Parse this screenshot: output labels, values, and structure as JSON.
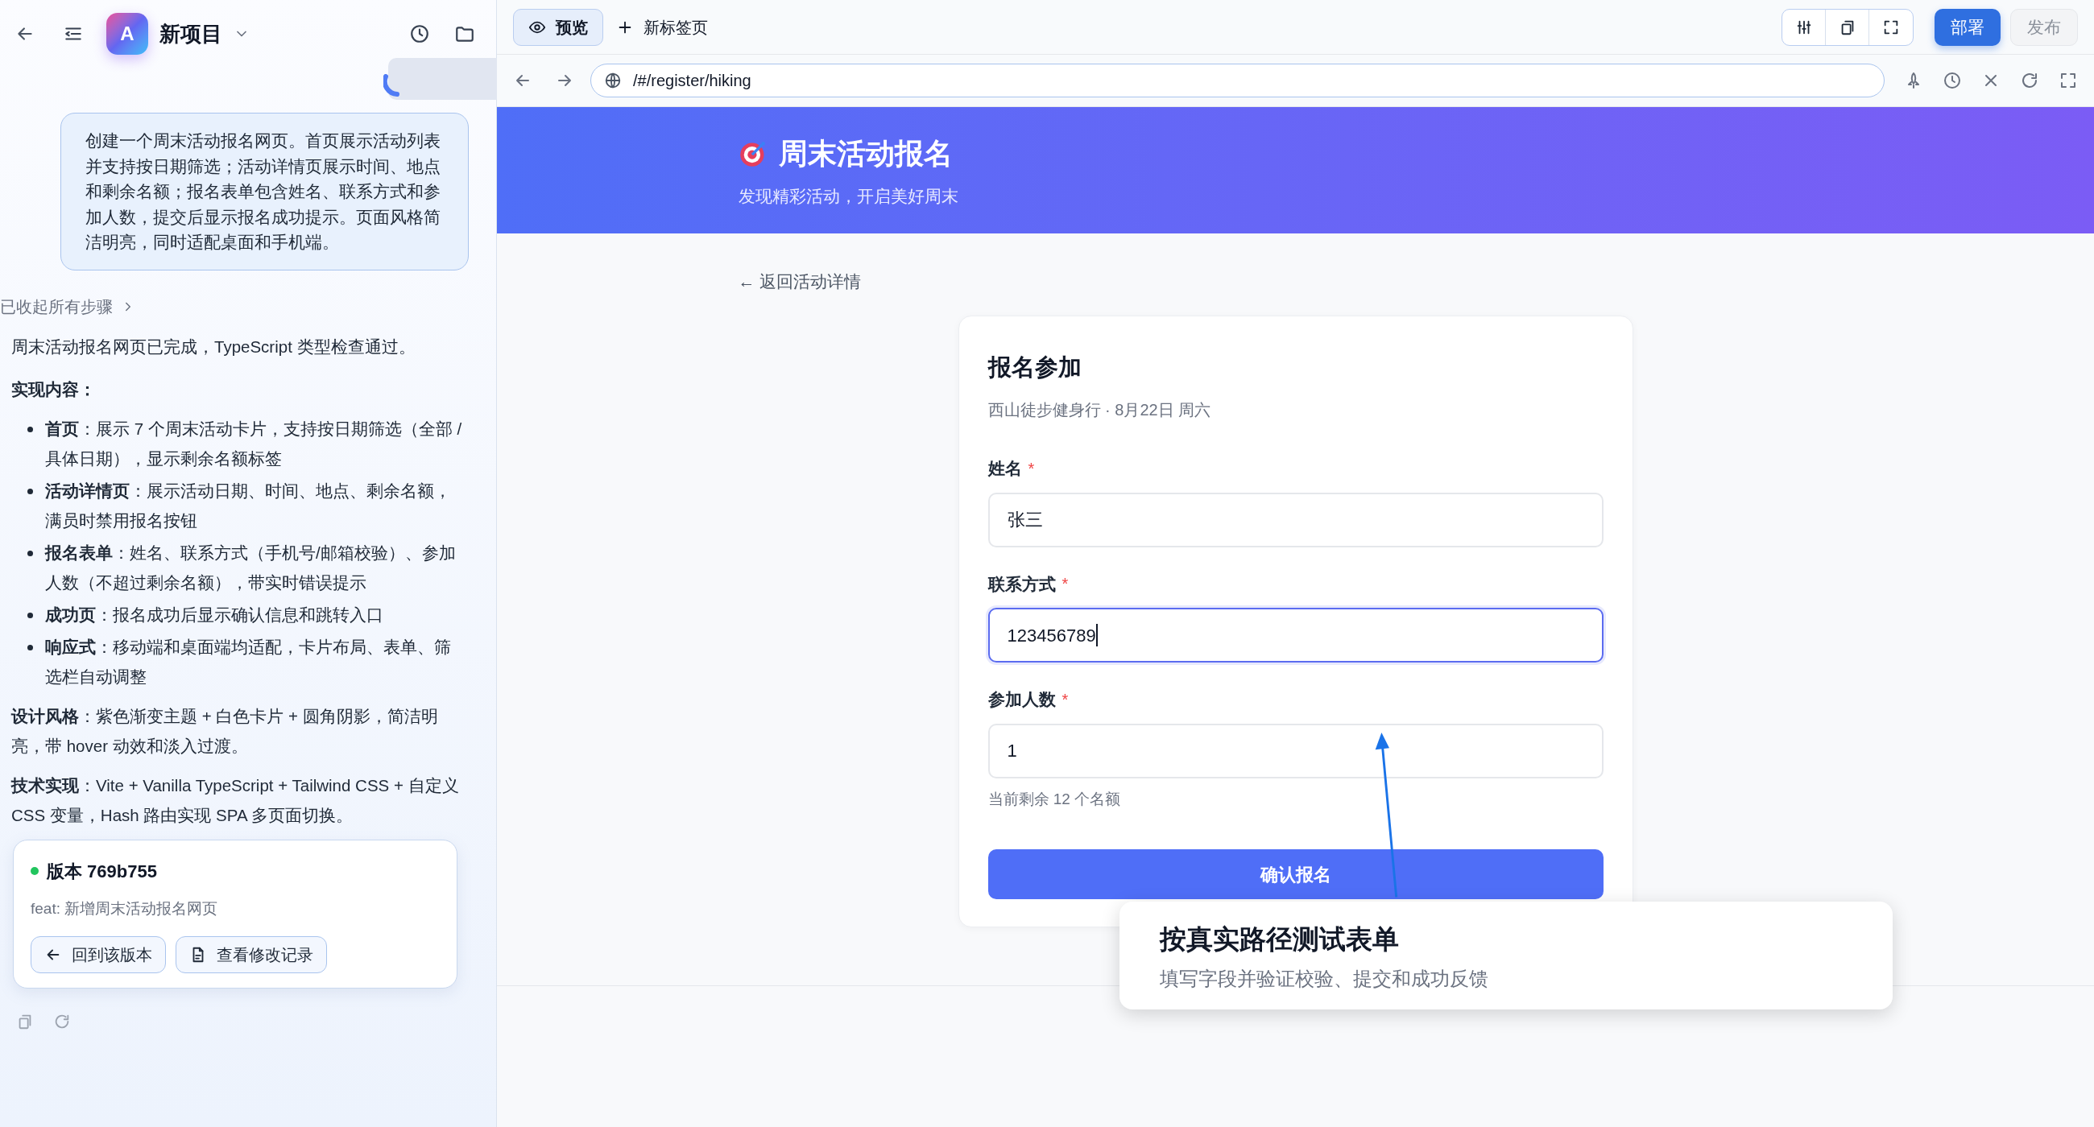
{
  "sidebar": {
    "project": {
      "avatar_letter": "A",
      "name": "新项目"
    },
    "user_message": "创建一个周末活动报名网页。首页展示活动列表并支持按日期筛选；活动详情页展示时间、地点和剩余名额；报名表单包含姓名、联系方式和参加人数，提交后显示报名成功提示。页面风格简洁明亮，同时适配桌面和手机端。",
    "steps_toggle": "已收起所有步骤",
    "reply": {
      "intro": "周末活动报名网页已完成，TypeScript 类型检查通过。",
      "heading": "实现内容：",
      "bullets": [
        "**首页**：展示 7 个周末活动卡片，支持按日期筛选（全部 / 具体日期），显示剩余名额标签",
        "**活动详情页**：展示活动日期、时间、地点、剩余名额，满员时禁用报名按钮",
        "**报名表单**：姓名、联系方式（手机号/邮箱校验）、参加人数（不超过剩余名额），带实时错误提示",
        "**成功页**：报名成功后显示确认信息和跳转入口",
        "**响应式**：移动端和桌面端均适配，卡片布局、表单、筛选栏自动调整"
      ],
      "paragraphs": [
        "**设计风格**：紫色渐变主题 + 白色卡片 + 圆角阴影，简洁明亮，带 hover 动效和淡入过渡。",
        "**技术实现**：Vite + Vanilla TypeScript + Tailwind CSS + 自定义 CSS 变量，Hash 路由实现 SPA 多页面切换。"
      ]
    },
    "version": {
      "color": "#22c55e",
      "title": "版本 769b755",
      "message": "feat: 新增周末活动报名网页",
      "buttons": [
        {
          "kind": "revert",
          "label": "回到该版本"
        },
        {
          "kind": "history",
          "label": "查看修改记录"
        }
      ]
    }
  },
  "toolbar": {
    "tabs": [
      {
        "label": "预览",
        "selected": true
      }
    ],
    "new_tab": "新标签页",
    "actions": [
      {
        "label": "部署",
        "disabled": false
      },
      {
        "label": "发布",
        "disabled": true
      }
    ]
  },
  "address_bar": {
    "url": "/#/register/hiking"
  },
  "page": {
    "banner": {
      "title": "周末活动报名",
      "subtitle": "发现精彩活动，开启美好周末"
    },
    "back_link": "← 返回活动详情",
    "form": {
      "title": "报名参加",
      "subtitle": "西山徒步健身行 · 8月22日 周六",
      "fields": [
        {
          "label": "姓名",
          "required_mark": "*",
          "value": "张三",
          "focused": false
        },
        {
          "label": "联系方式",
          "required_mark": "*",
          "value": "123456789",
          "focused": true
        },
        {
          "label": "参加人数",
          "required_mark": "*",
          "value": "1",
          "focused": false,
          "hint": "当前剩余 12 个名额"
        }
      ],
      "submit": "确认报名"
    }
  },
  "callout": {
    "title": "按真实路径测试表单",
    "text": "填写字段并验证校验、提交和成功反馈"
  }
}
